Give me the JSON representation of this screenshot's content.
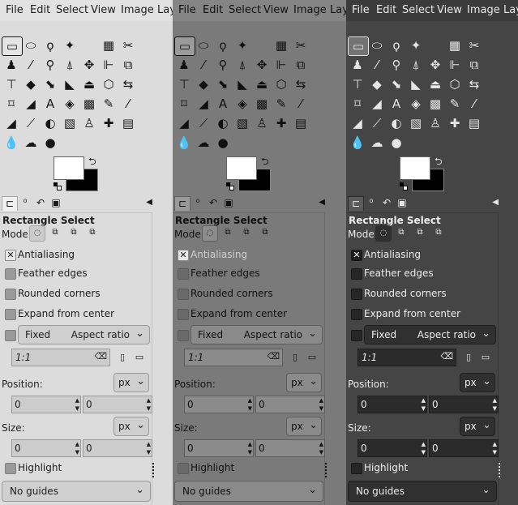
{
  "menu": [
    "File",
    "Edit",
    "Select",
    "View",
    "Image",
    "Lay"
  ],
  "tools": [
    [
      {
        "name": "rect-select-icon",
        "g": "▭"
      },
      {
        "name": "ellipse-select-icon",
        "g": "⬭"
      },
      {
        "name": "free-select-icon",
        "g": "ϙ"
      },
      {
        "name": "fuzzy-select-icon",
        "g": "✦"
      },
      {
        "name": "color-select-icon",
        "g": "▦"
      },
      {
        "name": "scissors-icon",
        "g": "✂"
      }
    ],
    [
      {
        "name": "foreground-select-icon",
        "g": "♟"
      },
      {
        "name": "color-picker-icon",
        "g": "⁄"
      },
      {
        "name": "zoom-icon",
        "g": "⚲"
      },
      {
        "name": "measure-icon",
        "g": "⍋"
      },
      {
        "name": "move-icon",
        "g": "✥"
      },
      {
        "name": "align-icon",
        "g": "⊩"
      },
      {
        "name": "crop-icon",
        "g": "⧉"
      }
    ],
    [
      {
        "name": "unified-transform-icon",
        "g": "⊤"
      },
      {
        "name": "rotate-icon",
        "g": "◆"
      },
      {
        "name": "scale-icon",
        "g": "⬊"
      },
      {
        "name": "shear-icon",
        "g": "◣"
      },
      {
        "name": "perspective-icon",
        "g": "⏏"
      },
      {
        "name": "3d-transform-icon",
        "g": "⬡"
      },
      {
        "name": "flip-icon",
        "g": "⇆"
      }
    ],
    [
      {
        "name": "cage-transform-icon",
        "g": "⌑"
      },
      {
        "name": "warp-icon",
        "g": "◢"
      },
      {
        "name": "text-icon",
        "g": "A"
      },
      {
        "name": "bucket-fill-icon",
        "g": "◈"
      },
      {
        "name": "gradient-icon",
        "g": "▩"
      },
      {
        "name": "pencil-icon",
        "g": "✎"
      },
      {
        "name": "paintbrush-icon",
        "g": "⁄"
      }
    ],
    [
      {
        "name": "eraser-icon",
        "g": "◢"
      },
      {
        "name": "airbrush-icon",
        "g": "⟋"
      },
      {
        "name": "ink-icon",
        "g": "◐"
      },
      {
        "name": "mypaint-icon",
        "g": "▧"
      },
      {
        "name": "clone-icon",
        "g": "♙"
      },
      {
        "name": "heal-icon",
        "g": "✚"
      },
      {
        "name": "perspective-clone-icon",
        "g": "▤"
      }
    ],
    [
      {
        "name": "blur-icon",
        "g": "💧"
      },
      {
        "name": "smudge-icon",
        "g": "☁"
      },
      {
        "name": "dodge-burn-icon",
        "g": "●"
      }
    ]
  ],
  "tool_options": {
    "title": "Rectangle Select",
    "mode_label": "Mode:",
    "antialiasing": "Antialiasing",
    "feather_edges": "Feather edges",
    "rounded_corners": "Rounded corners",
    "expand_from_center": "Expand from center",
    "fixed": "Fixed",
    "aspect_ratio": "Aspect ratio",
    "ratio_value": "1:1",
    "position_label": "Position:",
    "position_unit": "px",
    "position_x": "0",
    "position_y": "0",
    "size_label": "Size:",
    "size_unit": "px",
    "size_w": "0",
    "size_h": "0",
    "highlight": "Highlight",
    "guides": "No guides"
  }
}
